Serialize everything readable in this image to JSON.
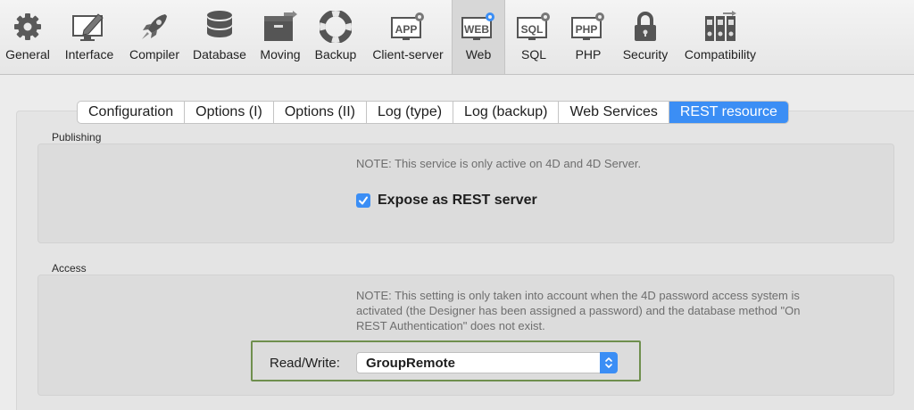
{
  "toolbar": {
    "items": [
      {
        "label": "General",
        "icon": "gear-icon"
      },
      {
        "label": "Interface",
        "icon": "screen-pencil-icon"
      },
      {
        "label": "Compiler",
        "icon": "rocket-icon"
      },
      {
        "label": "Database",
        "icon": "database-icon"
      },
      {
        "label": "Moving",
        "icon": "box-arrow-icon"
      },
      {
        "label": "Backup",
        "icon": "lifebuoy-icon"
      },
      {
        "label": "Client-server",
        "icon": "app-gear-icon",
        "icon_text": "APP"
      },
      {
        "label": "Web",
        "icon": "web-gear-icon",
        "icon_text": "WEB",
        "active": true
      },
      {
        "label": "SQL",
        "icon": "sql-gear-icon",
        "icon_text": "SQL"
      },
      {
        "label": "PHP",
        "icon": "php-gear-icon",
        "icon_text": "PHP"
      },
      {
        "label": "Security",
        "icon": "padlock-icon"
      },
      {
        "label": "Compatibility",
        "icon": "binders-icon"
      }
    ]
  },
  "tabs": [
    {
      "label": "Configuration"
    },
    {
      "label": "Options (I)"
    },
    {
      "label": "Options (II)"
    },
    {
      "label": "Log (type)"
    },
    {
      "label": "Log (backup)"
    },
    {
      "label": "Web Services"
    },
    {
      "label": "REST resource",
      "active": true
    }
  ],
  "publishing": {
    "heading": "Publishing",
    "note": "NOTE: This service is only active on 4D and 4D Server.",
    "expose_label": "Expose as REST server",
    "expose_checked": true
  },
  "access": {
    "heading": "Access",
    "note_line1": "NOTE: This setting is only taken into account when the 4D password access system is",
    "note_line2": "activated (the Designer has been assigned a password) and the database method \"On",
    "note_line3": "REST Authentication\" does not exist.",
    "rw_label": "Read/Write:",
    "rw_value": "GroupRemote"
  },
  "colors": {
    "accent": "#3b8ef5",
    "highlight_frame": "#6f8f4e"
  }
}
